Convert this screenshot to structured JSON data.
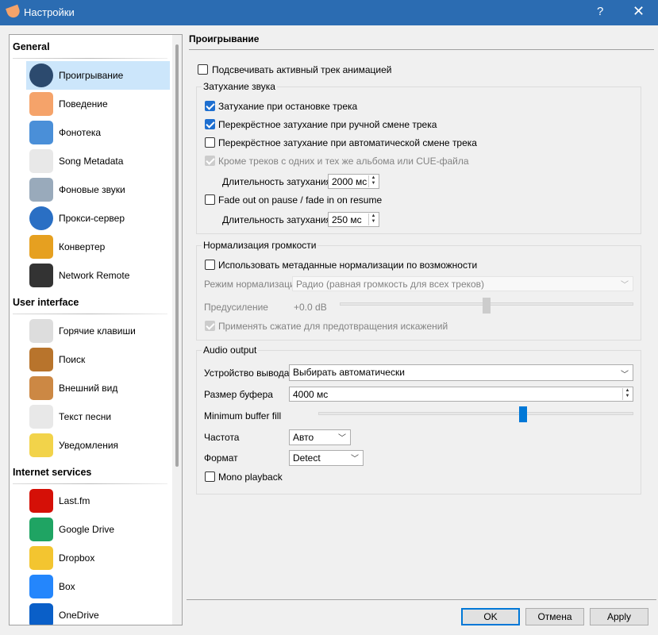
{
  "window": {
    "title": "Настройки",
    "help": "?",
    "close": "✕"
  },
  "sidebar": {
    "sections": [
      {
        "title": "General",
        "items": [
          {
            "label": "Проигрывание",
            "icon": "play-icon",
            "selected": true
          },
          {
            "label": "Поведение",
            "icon": "clementine-icon"
          },
          {
            "label": "Фонотека",
            "icon": "music-folder-icon"
          },
          {
            "label": "Song Metadata",
            "icon": "document-music-icon"
          },
          {
            "label": "Фоновые звуки",
            "icon": "weather-icon"
          },
          {
            "label": "Прокси-сервер",
            "icon": "globe-icon"
          },
          {
            "label": "Конвертер",
            "icon": "magic-wand-icon"
          },
          {
            "label": "Network Remote",
            "icon": "phone-icon"
          }
        ]
      },
      {
        "title": "User interface",
        "items": [
          {
            "label": "Горячие клавиши",
            "icon": "keyboard-icon"
          },
          {
            "label": "Поиск",
            "icon": "magnifier-icon"
          },
          {
            "label": "Внешний вид",
            "icon": "palette-icon"
          },
          {
            "label": "Текст песни",
            "icon": "lyrics-icon"
          },
          {
            "label": "Уведомления",
            "icon": "lightbulb-icon"
          }
        ]
      },
      {
        "title": "Internet services",
        "items": [
          {
            "label": "Last.fm",
            "icon": "lastfm-icon"
          },
          {
            "label": "Google Drive",
            "icon": "google-drive-icon"
          },
          {
            "label": "Dropbox",
            "icon": "dropbox-icon"
          },
          {
            "label": "Box",
            "icon": "box-icon"
          },
          {
            "label": "OneDrive",
            "icon": "onedrive-icon"
          }
        ]
      }
    ]
  },
  "page": {
    "title": "Проигрывание",
    "highlight_track": {
      "label": "Подсвечивать активный трек анимацией",
      "checked": false
    },
    "fade": {
      "title": "Затухание звука",
      "stop": {
        "label": "Затухание при остановке трека",
        "checked": true
      },
      "manual": {
        "label": "Перекрёстное затухание при ручной смене трека",
        "checked": true
      },
      "auto": {
        "label": "Перекрёстное затухание при автоматической смене трека",
        "checked": false
      },
      "except": {
        "label": "Кроме треков с одних и тех же альбома или CUE-файла",
        "checked": true,
        "disabled": true
      },
      "duration_label": "Длительность затухания",
      "duration_value": "2000 мс",
      "pause": {
        "label": "Fade out on pause / fade in on resume",
        "checked": false
      },
      "pause_duration_label": "Длительность затухания",
      "pause_duration_value": "250 мс"
    },
    "norm": {
      "title": "Нормализация громкости",
      "use_meta": {
        "label": "Использовать метаданные нормализации по возможности",
        "checked": false
      },
      "mode_label": "Режим нормализации",
      "mode_value": "Радио (равная громкость для всех треков)",
      "preamp_label": "Предусиление",
      "preamp_value": "+0.0 dB",
      "preamp_level": 0.5,
      "compress": {
        "label": "Применять сжатие для предотвращения искажений",
        "checked": true,
        "disabled": true
      }
    },
    "audio": {
      "title": "Audio output",
      "device_label": "Устройство вывода",
      "device_value": "Выбирать автоматически",
      "buffer_label": "Размер буфера",
      "buffer_value": "4000 мс",
      "minfill_label": "Minimum buffer fill",
      "minfill_level": 0.65,
      "rate_label": "Частота",
      "rate_value": "Авто",
      "format_label": "Формат",
      "format_value": "Detect",
      "mono": {
        "label": "Mono playback",
        "checked": false
      }
    }
  },
  "buttons": {
    "ok": "OK",
    "cancel": "Отмена",
    "apply": "Apply"
  },
  "colors": {
    "titlebar": "#2b6cb2",
    "selection": "#cce6fb",
    "accent": "#0078d7"
  }
}
